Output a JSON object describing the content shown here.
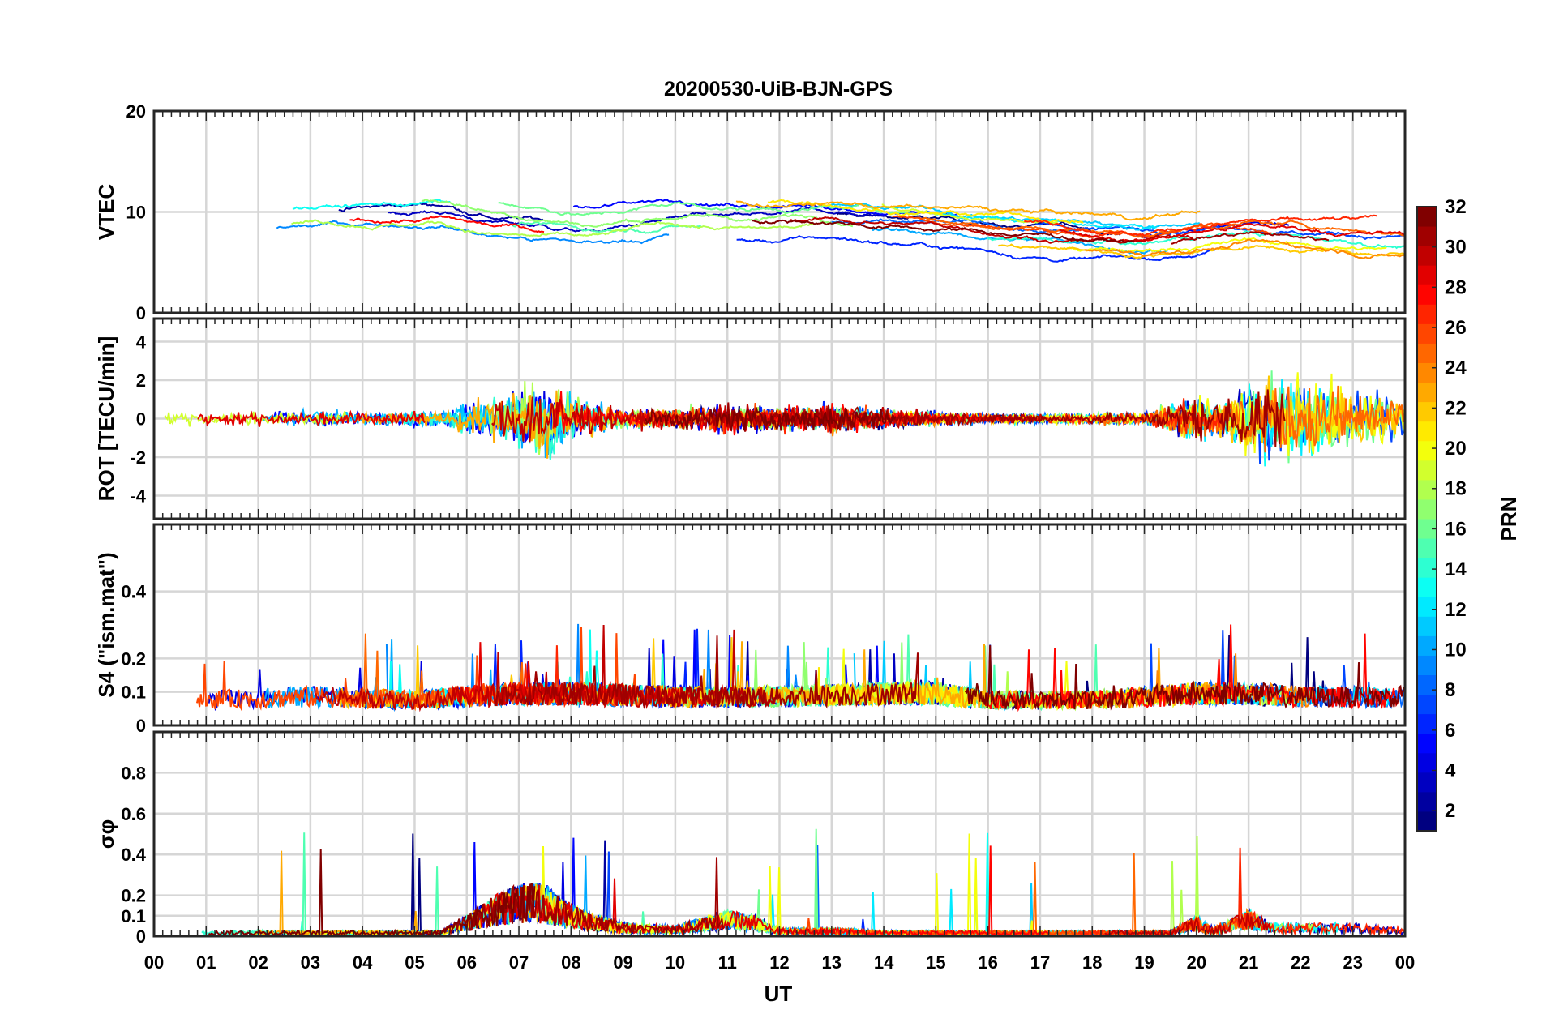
{
  "chart_data": {
    "type": "line",
    "title": "20200530-UiB-BJN-GPS",
    "xlabel": "UT",
    "x_ticks": [
      "00",
      "01",
      "02",
      "03",
      "04",
      "05",
      "06",
      "07",
      "08",
      "09",
      "10",
      "11",
      "12",
      "13",
      "14",
      "15",
      "16",
      "17",
      "18",
      "19",
      "20",
      "21",
      "22",
      "23",
      "00"
    ],
    "xlim_hours": [
      0,
      24
    ],
    "grid": true,
    "colorbar": {
      "label": "PRN",
      "range": [
        1,
        32
      ],
      "ticks": [
        2,
        4,
        6,
        8,
        10,
        12,
        14,
        16,
        18,
        20,
        22,
        24,
        26,
        28,
        30,
        32
      ],
      "colormap": "jet",
      "placement": "right"
    },
    "panels": [
      {
        "ylabel": "VTEC",
        "ylim": [
          0,
          20
        ],
        "yticks": [
          0,
          10,
          20
        ],
        "tick_labels": [
          "0",
          "10",
          "20"
        ],
        "profile_hours": [
          0,
          2,
          4,
          5.5,
          6.5,
          7.5,
          8.5,
          10,
          11.5,
          13,
          15,
          17,
          19,
          20,
          21,
          22,
          24
        ],
        "profile_values": [
          9.5,
          9.8,
          10.2,
          10.5,
          9.5,
          9,
          8.5,
          9.5,
          9,
          9.2,
          8.5,
          7.8,
          7.2,
          8,
          8.5,
          8,
          7.5
        ]
      },
      {
        "ylabel": "ROT [TECU/min]",
        "ylim": [
          -5.2,
          5.2
        ],
        "yticks": [
          -4,
          -2,
          0,
          2,
          4
        ],
        "tick_labels": [
          "-4",
          "-2",
          "0",
          "2",
          "4"
        ],
        "profile_hours": [
          0,
          5.5,
          6,
          7,
          7.6,
          8,
          9,
          10,
          11,
          12,
          13,
          14,
          16,
          19,
          19.5,
          20,
          20.5,
          21,
          22,
          23,
          24
        ],
        "profile_values": [
          0.35,
          0.4,
          0.9,
          1.6,
          2.2,
          1.2,
          0.5,
          0.6,
          0.8,
          0.6,
          0.8,
          0.5,
          0.25,
          0.3,
          0.8,
          1.4,
          0.9,
          2.2,
          2.0,
          1.8,
          1.0
        ]
      },
      {
        "ylabel": "S4 (\"ism.mat\")",
        "ylim": [
          0,
          0.6
        ],
        "yticks": [
          0,
          0.1,
          0.2,
          0.4
        ],
        "tick_labels": [
          "0",
          "0.1",
          "0.2",
          "0.4"
        ],
        "profile_hours": [
          0,
          1,
          3,
          5,
          7,
          8,
          10,
          12,
          14,
          15,
          16,
          18,
          20,
          21,
          22,
          24
        ],
        "profile_values": [
          0.1,
          0.08,
          0.09,
          0.08,
          0.1,
          0.1,
          0.09,
          0.09,
          0.1,
          0.1,
          0.08,
          0.08,
          0.1,
          0.1,
          0.09,
          0.09
        ]
      },
      {
        "ylabel": "σφ",
        "ylim": [
          0,
          1
        ],
        "yticks": [
          0,
          0.1,
          0.2,
          0.4,
          0.6,
          0.8
        ],
        "tick_labels": [
          "0",
          "0.1",
          "0.2",
          "0.4",
          "0.6",
          "0.8"
        ],
        "profile_hours": [
          0,
          5.5,
          6,
          6.5,
          7,
          7.5,
          7.8,
          8.2,
          9,
          10,
          11,
          11.5,
          12,
          13,
          14,
          19.5,
          20,
          20.3,
          21,
          21.5,
          22,
          23,
          24
        ],
        "profile_values": [
          0.02,
          0.02,
          0.08,
          0.15,
          0.2,
          0.2,
          0.15,
          0.1,
          0.05,
          0.04,
          0.1,
          0.08,
          0.03,
          0.03,
          0.02,
          0.02,
          0.08,
          0.03,
          0.1,
          0.05,
          0.05,
          0.05,
          0.03
        ]
      }
    ]
  }
}
